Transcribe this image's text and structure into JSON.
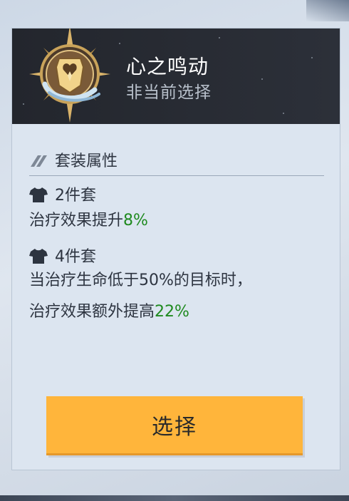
{
  "card": {
    "title": "心之鸣动",
    "subtitle": "非当前选择",
    "emblem_icon": "heart-shield-emblem-icon"
  },
  "attributes": {
    "section_title": "套装属性",
    "section_icon": "double-slash-icon",
    "piece_icon": "shirt-icon",
    "set2": {
      "label": "2件套",
      "desc_prefix": "治疗效果提升",
      "desc_value": "8%"
    },
    "set4": {
      "label": "4件套",
      "desc_line1": "当治疗生命低于50%的目标时，",
      "desc_prefix": "治疗效果额外提高",
      "desc_value": "22%"
    }
  },
  "button": {
    "label": "选择"
  },
  "colors": {
    "highlight": "#1f8a1f",
    "button": "#ffb53b",
    "header": "#23262d"
  }
}
